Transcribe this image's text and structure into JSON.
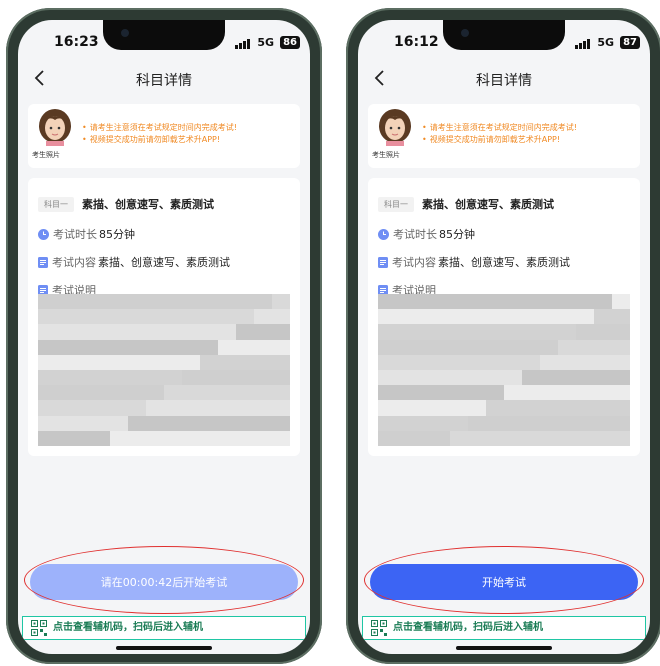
{
  "phones": [
    {
      "time": "16:23",
      "network": "5G",
      "battery": "86",
      "title": "科目详情",
      "notices": [
        "请考生注意须在考试规定时间内完成考试!",
        "视频提交成功前请勿卸载艺术升APP!"
      ],
      "avatar_caption": "考生照片",
      "subject_tag": "科目一",
      "subject_name": "素描、创意速写、素质测试",
      "duration_label": "考试时长",
      "duration_value": "85分钟",
      "content_label": "考试内容",
      "content_value": "素描、创意速写、素质测试",
      "desc_label": "考试说明",
      "button_label": "请在00:00:42后开始考试",
      "button_state": "disabled",
      "qr_text": "点击查看辅机码，扫码后进入辅机"
    },
    {
      "time": "16:12",
      "network": "5G",
      "battery": "87",
      "title": "科目详情",
      "notices": [
        "请考生注意须在考试规定时间内完成考试!",
        "视频提交成功前请勿卸载艺术升APP!"
      ],
      "avatar_caption": "考生照片",
      "subject_tag": "科目一",
      "subject_name": "素描、创意速写、素质测试",
      "duration_label": "考试时长",
      "duration_value": "85分钟",
      "content_label": "考试内容",
      "content_value": "素描、创意速写、素质测试",
      "desc_label": "考试说明",
      "button_label": "开始考试",
      "button_state": "enabled",
      "qr_text": "点击查看辅机码，扫码后进入辅机"
    }
  ],
  "colors": {
    "accent": "#3c64f4",
    "accent_disabled": "#9db2fb",
    "notice": "#f08a24",
    "highlight_ellipse": "#e0302f",
    "qr_border": "#1fc6a4"
  }
}
